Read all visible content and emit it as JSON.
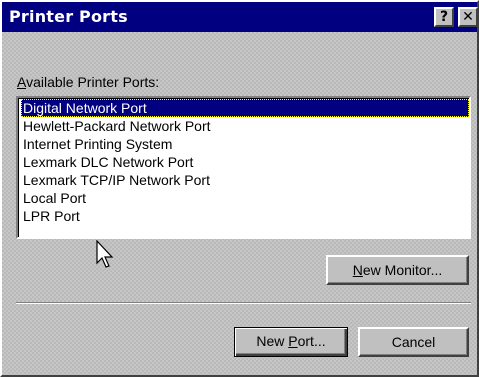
{
  "window": {
    "title": "Printer Ports",
    "help_button": "?",
    "close_button": "✕"
  },
  "ports_label": {
    "mnemonic": "A",
    "rest": "vailable Printer Ports:"
  },
  "ports": [
    "Digital Network Port",
    "Hewlett-Packard Network Port",
    "Internet Printing System",
    "Lexmark DLC Network Port",
    "Lexmark TCP/IP Network Port",
    "Local Port",
    "LPR Port"
  ],
  "selected_port": "Digital Network Port",
  "buttons": {
    "new_monitor_mnemonic": "N",
    "new_monitor_rest": "ew Monitor...",
    "new_port_prefix": "New ",
    "new_port_mnemonic": "P",
    "new_port_rest": "ort...",
    "cancel": "Cancel"
  },
  "colors": {
    "titlebar": "#000080",
    "selection": "#000080",
    "face": "#c0c0c0"
  },
  "icons": {
    "cursor": "arrow-cursor-icon"
  }
}
